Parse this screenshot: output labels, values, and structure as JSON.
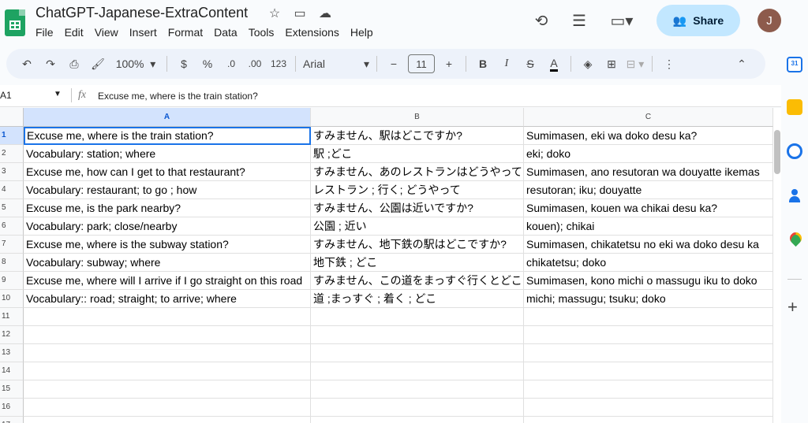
{
  "doc": {
    "title": "ChatGPT-Japanese-ExtraContent"
  },
  "title_icons": [
    "star-icon",
    "move-folder-icon",
    "cloud-status-icon"
  ],
  "menu": [
    "File",
    "Edit",
    "View",
    "Insert",
    "Format",
    "Data",
    "Tools",
    "Extensions",
    "Help"
  ],
  "top_right": {
    "share_label": "Share",
    "avatar_initial": "J"
  },
  "toolbar": {
    "zoom": "100%",
    "currency": "$",
    "percent": "%",
    "decrease_decimal": ".0",
    "increase_decimal": ".00",
    "more_formats": "123",
    "font": "Arial",
    "minus": "−",
    "font_size": "11",
    "plus": "+",
    "bold": "B",
    "italic": "I",
    "strike": "S",
    "text_color": "A"
  },
  "formula_bar": {
    "cell_ref": "A1",
    "fx": "fx",
    "content": "Excuse me, where is the train station?"
  },
  "columns": [
    "A",
    "B",
    "C"
  ],
  "rows": [
    {
      "num": "1",
      "a": "Excuse me, where is the train station?",
      "b": "すみません、駅はどこですか?",
      "c": "Sumimasen, eki wa doko desu ka?"
    },
    {
      "num": "2",
      "a": "Vocabulary: station;  where",
      "b": "駅 ;どこ",
      "c": "eki; doko"
    },
    {
      "num": "3",
      "a": "Excuse me, how can I get to that restaurant?",
      "b": "すみません、あのレストランはどうやって",
      "c": "Sumimasen, ano resutoran wa douyatte ikemas"
    },
    {
      "num": "4",
      "a": "Vocabulary: restaurant;  to go ; how",
      "b": "レストラン ; 行く; どうやって",
      "c": "resutoran; iku; douyatte"
    },
    {
      "num": "5",
      "a": "Excuse me, is the park nearby?",
      "b": "すみません、公園は近いですか?",
      "c": "Sumimasen, kouen wa chikai desu ka?"
    },
    {
      "num": "6",
      "a": "Vocabulary:  park; close/nearby",
      "b": "公園 ; 近い",
      "c": "kouen); chikai"
    },
    {
      "num": "7",
      "a": "Excuse me, where is the subway station?",
      "b": "すみません、地下鉄の駅はどこですか?",
      "c": "Sumimasen, chikatetsu no eki wa doko desu ka"
    },
    {
      "num": "8",
      "a": "Vocabulary: subway; where",
      "b": "地下鉄 ; どこ",
      "c": "chikatetsu; doko"
    },
    {
      "num": "9",
      "a": "Excuse me, where will I arrive if I go straight on this road",
      "b": "すみません、この道をまっすぐ行くとどこ",
      "c": "Sumimasen, kono michi o massugu iku to doko"
    },
    {
      "num": "10",
      "a": "Vocabulary:: road; straight; to arrive; where",
      "b": "道 ;まっすぐ ; 着く ; どこ",
      "c": "michi; massugu; tsuku; doko"
    },
    {
      "num": "11",
      "a": "",
      "b": "",
      "c": ""
    },
    {
      "num": "12",
      "a": "",
      "b": "",
      "c": ""
    },
    {
      "num": "13",
      "a": "",
      "b": "",
      "c": ""
    },
    {
      "num": "14",
      "a": "",
      "b": "",
      "c": ""
    },
    {
      "num": "15",
      "a": "",
      "b": "",
      "c": ""
    },
    {
      "num": "16",
      "a": "",
      "b": "",
      "c": ""
    },
    {
      "num": "17",
      "a": "",
      "b": "",
      "c": ""
    }
  ],
  "side_panel": {
    "calendar_day": "31"
  },
  "colors": {
    "accent": "#1a73e8",
    "share_bg": "#c2e7ff",
    "selected_header": "#d3e3fd",
    "sheets_green": "#1ea362"
  }
}
